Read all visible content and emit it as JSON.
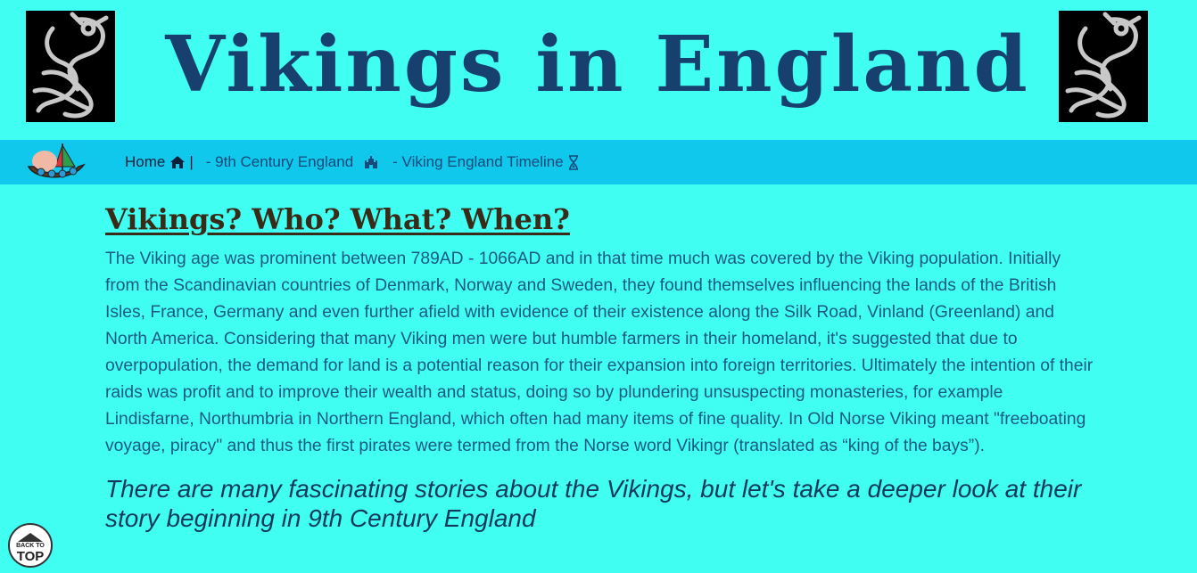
{
  "header": {
    "title": "Vikings in England",
    "left_image_icon": "knotwork-dragon-icon",
    "right_image_icon": "knotwork-dragon-icon"
  },
  "nav": {
    "logo_icon": "viking-ship-icon",
    "home_label": "Home",
    "home_icon": "home-icon",
    "separator": "|",
    "link_1_label": "- 9th Century England",
    "link_1_icon": "castle-icon",
    "link_2_label": "- Viking England Timeline",
    "link_2_icon": "hourglass-icon"
  },
  "main": {
    "heading": "Vikings? Who? What? When?",
    "intro": "The Viking age was prominent between 789AD - 1066AD and in that time much was covered by the Viking population. Initially from the Scandinavian countries of Denmark, Norway and Sweden, they found themselves influencing the lands of the British Isles, France, Germany and even further afield with evidence of their existence along the Silk Road, Vinland (Greenland) and North America. Considering that many Viking men were but humble farmers in their homeland, it's suggested that due to overpopulation, the demand for land is a potential reason for their expansion into foreign territories. Ultimately the intention of their raids was profit and to improve their wealth and status, doing so by plundering unsuspecting monasteries, for example Lindisfarne, Northumbria in Northern England, which often had many items of fine quality. In Old Norse Viking meant \"freeboating voyage, piracy\" and thus the first pirates were termed from the Norse word Vikingr (translated as “king of the bays”).",
    "quote": "There are many fascinating stories about the Vikings, but let's take a deeper look at their story beginning in 9th Century England"
  },
  "back_to_top": {
    "line1": "BACK TO",
    "line2": "TOP"
  },
  "colors": {
    "page_bg": "#40fef2",
    "nav_bg": "#10c7ec",
    "title": "#17406e",
    "heading": "#3a2a18",
    "body_text": "#1a5a82"
  }
}
